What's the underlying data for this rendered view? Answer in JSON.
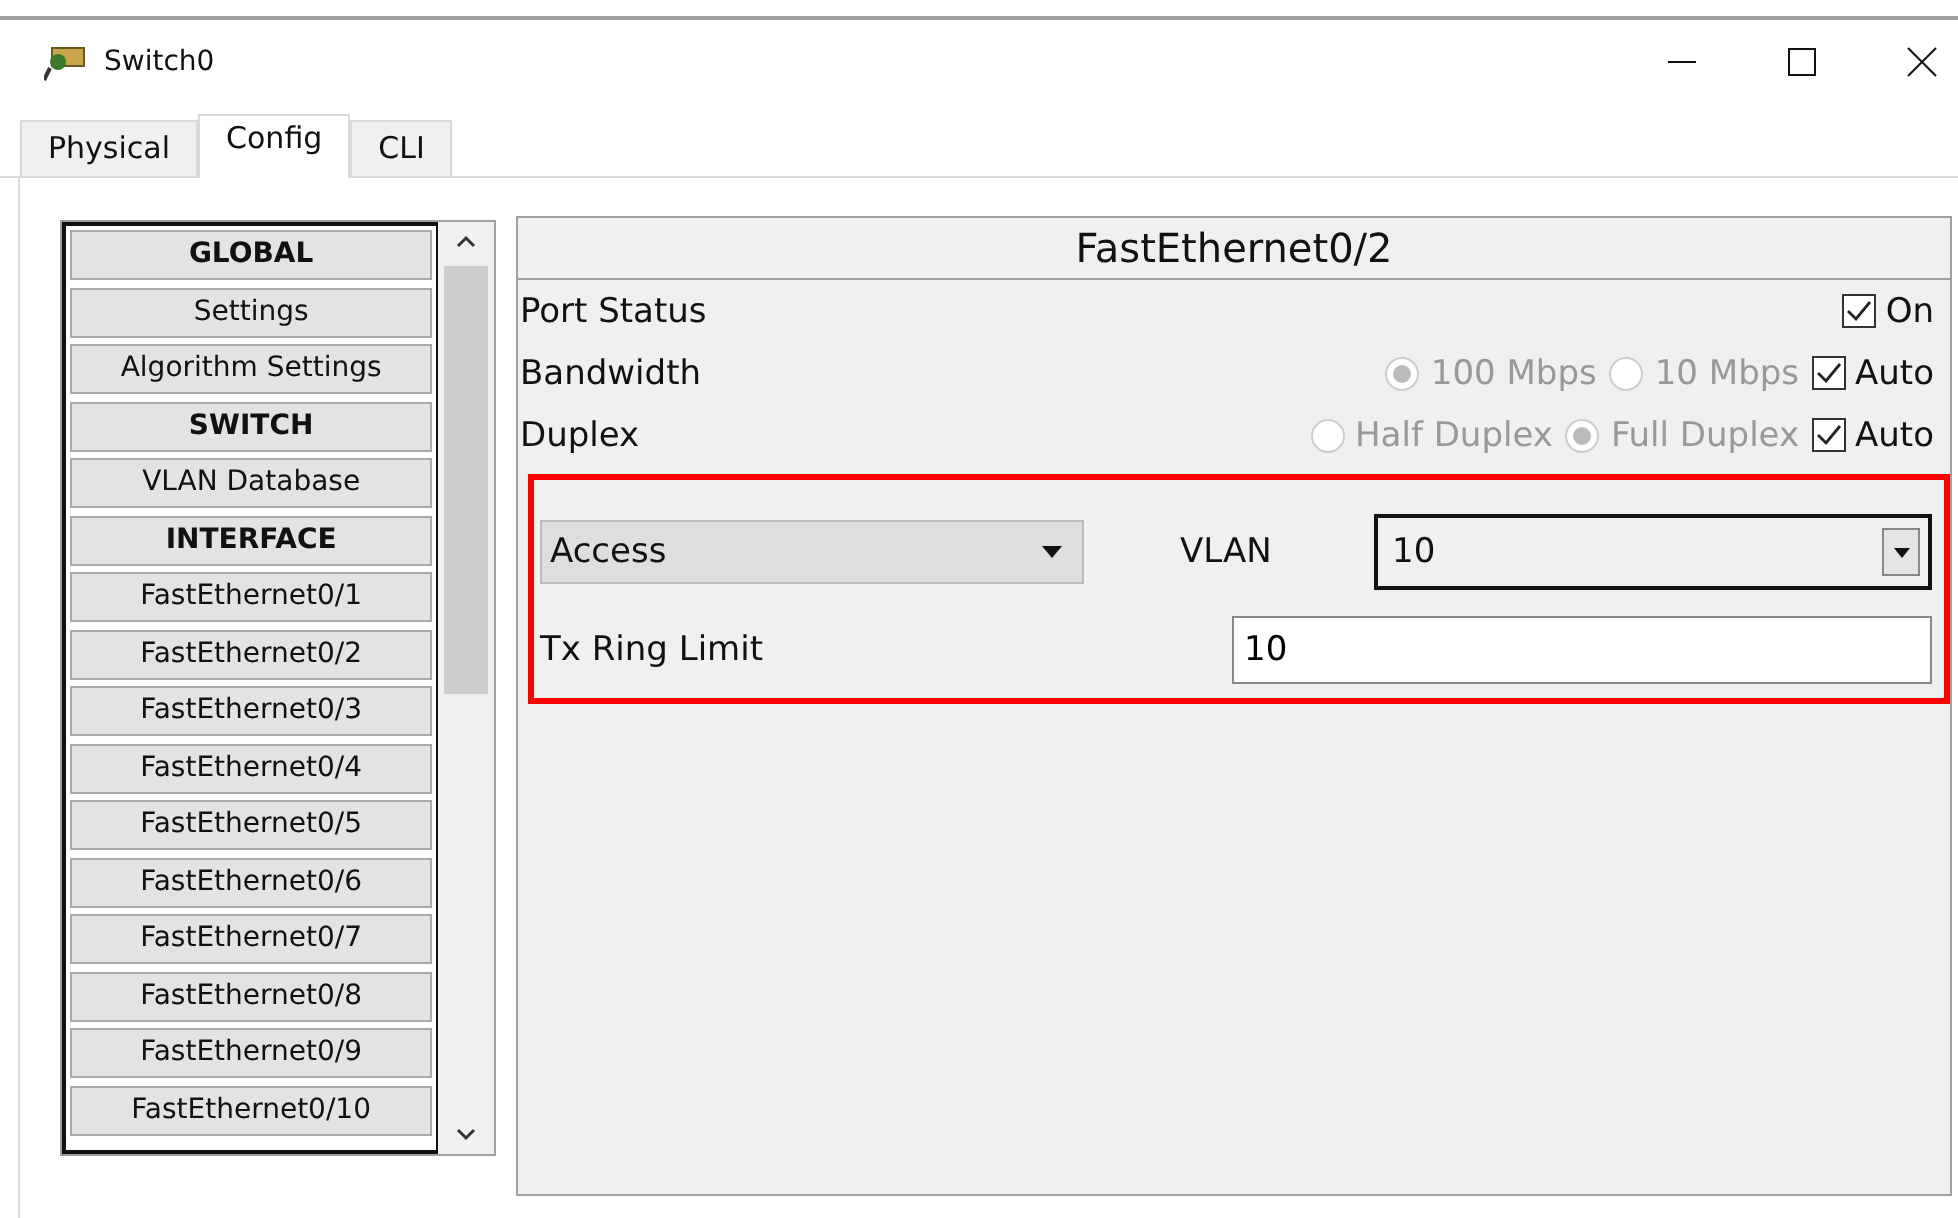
{
  "window": {
    "title": "Switch0"
  },
  "tabs": [
    {
      "label": "Physical",
      "selected": false
    },
    {
      "label": "Config",
      "selected": true
    },
    {
      "label": "CLI",
      "selected": false
    }
  ],
  "sidebar": {
    "items": [
      {
        "label": "GLOBAL",
        "kind": "header"
      },
      {
        "label": "Settings",
        "kind": "item"
      },
      {
        "label": "Algorithm Settings",
        "kind": "item"
      },
      {
        "label": "SWITCH",
        "kind": "header"
      },
      {
        "label": "VLAN Database",
        "kind": "item"
      },
      {
        "label": "INTERFACE",
        "kind": "header"
      },
      {
        "label": "FastEthernet0/1",
        "kind": "item"
      },
      {
        "label": "FastEthernet0/2",
        "kind": "item"
      },
      {
        "label": "FastEthernet0/3",
        "kind": "item"
      },
      {
        "label": "FastEthernet0/4",
        "kind": "item"
      },
      {
        "label": "FastEthernet0/5",
        "kind": "item"
      },
      {
        "label": "FastEthernet0/6",
        "kind": "item"
      },
      {
        "label": "FastEthernet0/7",
        "kind": "item"
      },
      {
        "label": "FastEthernet0/8",
        "kind": "item"
      },
      {
        "label": "FastEthernet0/9",
        "kind": "item"
      },
      {
        "label": "FastEthernet0/10",
        "kind": "item"
      }
    ]
  },
  "panel": {
    "title": "FastEthernet0/2",
    "rows": [
      {
        "label": "Port Status",
        "options": [
          {
            "kind": "checkbox",
            "label": "On",
            "checked": true,
            "disabled": false
          }
        ]
      },
      {
        "label": "Bandwidth",
        "options": [
          {
            "kind": "radio",
            "label": "100 Mbps",
            "selected": true,
            "disabled": true
          },
          {
            "kind": "radio",
            "label": "10 Mbps",
            "selected": false,
            "disabled": true
          },
          {
            "kind": "checkbox",
            "label": "Auto",
            "checked": true,
            "disabled": false
          }
        ]
      },
      {
        "label": "Duplex",
        "options": [
          {
            "kind": "radio",
            "label": "Half Duplex",
            "selected": false,
            "disabled": true
          },
          {
            "kind": "radio",
            "label": "Full Duplex",
            "selected": true,
            "disabled": true
          },
          {
            "kind": "checkbox",
            "label": "Auto",
            "checked": true,
            "disabled": false
          }
        ]
      }
    ],
    "mode": {
      "value": "Access"
    },
    "vlan": {
      "label": "VLAN",
      "value": "10"
    },
    "tx_ring_limit": {
      "label": "Tx Ring Limit",
      "value": "10"
    }
  }
}
